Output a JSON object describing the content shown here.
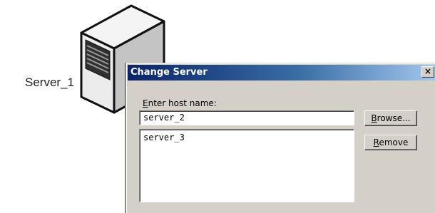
{
  "desktop": {
    "server_label": "Server_1",
    "server_icon": "server-tower-icon"
  },
  "dialog": {
    "title": "Change Server",
    "close_label": "×",
    "prompt_mnemonic": "E",
    "prompt_rest": "nter host name:",
    "host_input_value": "server_2",
    "host_list": [
      "server_3"
    ],
    "browse": {
      "mnemonic": "B",
      "rest": "rowse..."
    },
    "remove": {
      "mnemonic": "R",
      "rest": "emove"
    }
  },
  "colors": {
    "titlebar_start": "#0a246a",
    "titlebar_end": "#a6caf0",
    "dialog_face": "#d4d0c8"
  }
}
